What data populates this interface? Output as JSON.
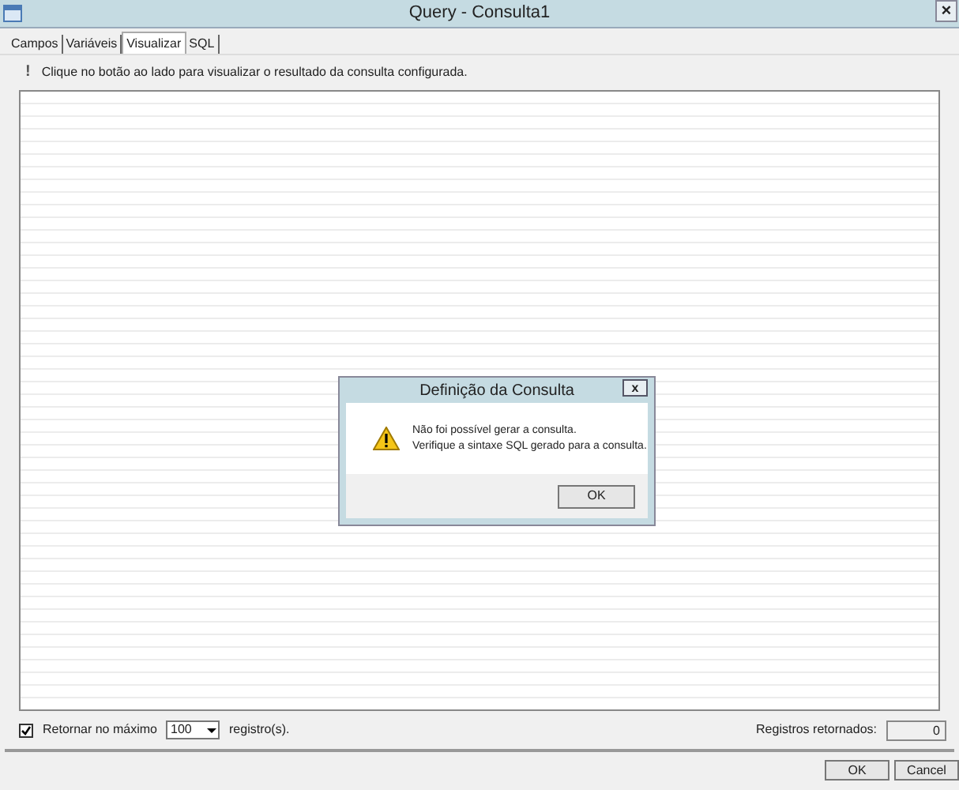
{
  "window": {
    "title": "Query - Consulta1",
    "close": "×"
  },
  "tabs": [
    {
      "label": "Campos",
      "selected": false
    },
    {
      "label": "Variáveis",
      "selected": false
    },
    {
      "label": "Visualizar",
      "selected": true
    },
    {
      "label": "SQL",
      "selected": false
    }
  ],
  "info": {
    "icon": "!",
    "text": "Clique no botão ao lado para visualizar o resultado da consulta configurada."
  },
  "dialog": {
    "title": "Definição da Consulta",
    "close": "x",
    "lines": [
      "Não foi possível gerar a consulta.",
      "Verifique a sintaxe SQL gerado para a consulta."
    ],
    "button": "OK"
  },
  "limit": {
    "checked": true,
    "label": "Retornar no máximo",
    "value": "100",
    "suffix": "registro(s)."
  },
  "returned": {
    "label": "Registros retornados:",
    "value": "0"
  },
  "buttons": [
    "OK",
    "Cancel"
  ]
}
